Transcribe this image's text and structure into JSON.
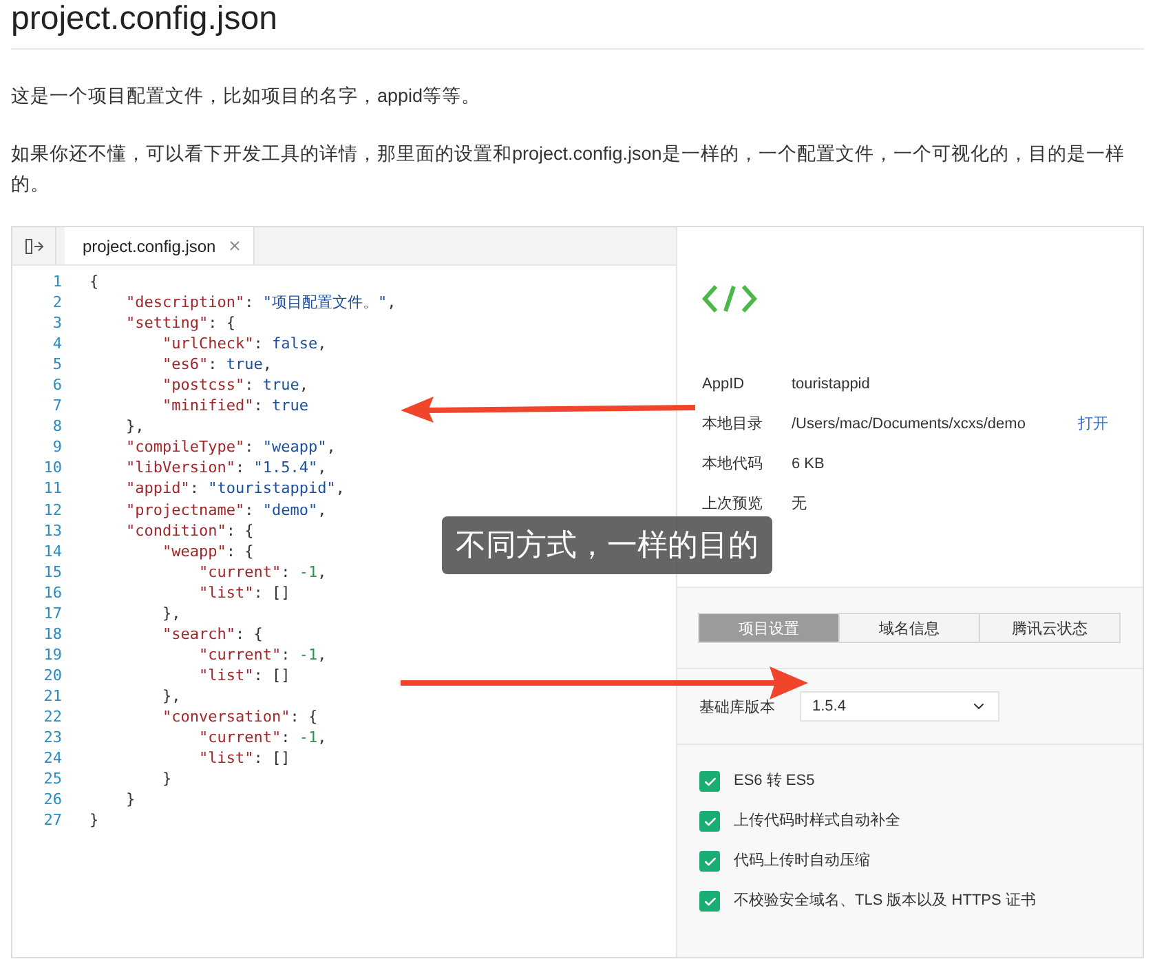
{
  "title": "project.config.json",
  "paragraphs": [
    "这是一个项目配置文件，比如项目的名字，appid等等。",
    "如果你还不懂，可以看下开发工具的详情，那里面的设置和project.config.json是一样的，一个配置文件，一个可视化的，目的是一样的。"
  ],
  "screenshot": {
    "editor": {
      "tab": {
        "label": "project.config.json",
        "selected": true
      },
      "lines": [
        {
          "num": "1",
          "tokens": [
            {
              "kind": "punct",
              "text": "{"
            }
          ]
        },
        {
          "num": "2",
          "tokens": [
            {
              "kind": "key",
              "text": "    \"description\""
            },
            {
              "kind": "punct",
              "text": ": "
            },
            {
              "kind": "string",
              "text": "\"项目配置文件。\""
            },
            {
              "kind": "punct",
              "text": ","
            }
          ]
        },
        {
          "num": "3",
          "tokens": [
            {
              "kind": "key",
              "text": "    \"setting\""
            },
            {
              "kind": "punct",
              "text": ": {"
            }
          ]
        },
        {
          "num": "4",
          "tokens": [
            {
              "kind": "key",
              "text": "        \"urlCheck\""
            },
            {
              "kind": "punct",
              "text": ": "
            },
            {
              "kind": "literal",
              "text": "false"
            },
            {
              "kind": "punct",
              "text": ","
            }
          ]
        },
        {
          "num": "5",
          "tokens": [
            {
              "kind": "key",
              "text": "        \"es6\""
            },
            {
              "kind": "punct",
              "text": ": "
            },
            {
              "kind": "literal",
              "text": "true"
            },
            {
              "kind": "punct",
              "text": ","
            }
          ]
        },
        {
          "num": "6",
          "tokens": [
            {
              "kind": "key",
              "text": "        \"postcss\""
            },
            {
              "kind": "punct",
              "text": ": "
            },
            {
              "kind": "literal",
              "text": "true"
            },
            {
              "kind": "punct",
              "text": ","
            }
          ]
        },
        {
          "num": "7",
          "tokens": [
            {
              "kind": "key",
              "text": "        \"minified\""
            },
            {
              "kind": "punct",
              "text": ": "
            },
            {
              "kind": "literal",
              "text": "true"
            }
          ]
        },
        {
          "num": "8",
          "tokens": [
            {
              "kind": "punct",
              "text": "    },"
            }
          ]
        },
        {
          "num": "9",
          "tokens": [
            {
              "kind": "key",
              "text": "    \"compileType\""
            },
            {
              "kind": "punct",
              "text": ": "
            },
            {
              "kind": "string",
              "text": "\"weapp\""
            },
            {
              "kind": "punct",
              "text": ","
            }
          ]
        },
        {
          "num": "10",
          "tokens": [
            {
              "kind": "key",
              "text": "    \"libVersion\""
            },
            {
              "kind": "punct",
              "text": ": "
            },
            {
              "kind": "string",
              "text": "\"1.5.4\""
            },
            {
              "kind": "punct",
              "text": ","
            }
          ]
        },
        {
          "num": "11",
          "tokens": [
            {
              "kind": "key",
              "text": "    \"appid\""
            },
            {
              "kind": "punct",
              "text": ": "
            },
            {
              "kind": "string",
              "text": "\"touristappid\""
            },
            {
              "kind": "punct",
              "text": ","
            }
          ]
        },
        {
          "num": "12",
          "tokens": [
            {
              "kind": "key",
              "text": "    \"projectname\""
            },
            {
              "kind": "punct",
              "text": ": "
            },
            {
              "kind": "string",
              "text": "\"demo\""
            },
            {
              "kind": "punct",
              "text": ","
            }
          ]
        },
        {
          "num": "13",
          "tokens": [
            {
              "kind": "key",
              "text": "    \"condition\""
            },
            {
              "kind": "punct",
              "text": ": {"
            }
          ]
        },
        {
          "num": "14",
          "tokens": [
            {
              "kind": "key",
              "text": "        \"weapp\""
            },
            {
              "kind": "punct",
              "text": ": {"
            }
          ]
        },
        {
          "num": "15",
          "tokens": [
            {
              "kind": "key",
              "text": "            \"current\""
            },
            {
              "kind": "punct",
              "text": ": "
            },
            {
              "kind": "number",
              "text": "-1"
            },
            {
              "kind": "punct",
              "text": ","
            }
          ]
        },
        {
          "num": "16",
          "tokens": [
            {
              "kind": "key",
              "text": "            \"list\""
            },
            {
              "kind": "punct",
              "text": ": []"
            }
          ]
        },
        {
          "num": "17",
          "tokens": [
            {
              "kind": "punct",
              "text": "        },"
            }
          ]
        },
        {
          "num": "18",
          "tokens": [
            {
              "kind": "key",
              "text": "        \"search\""
            },
            {
              "kind": "punct",
              "text": ": {"
            }
          ]
        },
        {
          "num": "19",
          "tokens": [
            {
              "kind": "key",
              "text": "            \"current\""
            },
            {
              "kind": "punct",
              "text": ": "
            },
            {
              "kind": "number",
              "text": "-1"
            },
            {
              "kind": "punct",
              "text": ","
            }
          ]
        },
        {
          "num": "20",
          "tokens": [
            {
              "kind": "key",
              "text": "            \"list\""
            },
            {
              "kind": "punct",
              "text": ": []"
            }
          ]
        },
        {
          "num": "21",
          "tokens": [
            {
              "kind": "punct",
              "text": "        },"
            }
          ]
        },
        {
          "num": "22",
          "tokens": [
            {
              "kind": "key",
              "text": "        \"conversation\""
            },
            {
              "kind": "punct",
              "text": ": {"
            }
          ]
        },
        {
          "num": "23",
          "tokens": [
            {
              "kind": "key",
              "text": "            \"current\""
            },
            {
              "kind": "punct",
              "text": ": "
            },
            {
              "kind": "number",
              "text": "-1"
            },
            {
              "kind": "punct",
              "text": ","
            }
          ]
        },
        {
          "num": "24",
          "tokens": [
            {
              "kind": "key",
              "text": "            \"list\""
            },
            {
              "kind": "punct",
              "text": ": []"
            }
          ]
        },
        {
          "num": "25",
          "tokens": [
            {
              "kind": "punct",
              "text": "        }"
            }
          ]
        },
        {
          "num": "26",
          "tokens": [
            {
              "kind": "punct",
              "text": "    }"
            }
          ]
        },
        {
          "num": "27",
          "tokens": [
            {
              "kind": "punct",
              "text": "}"
            }
          ]
        }
      ]
    },
    "details": {
      "rows": [
        {
          "label": "AppID",
          "value": "touristappid"
        },
        {
          "label": "本地目录",
          "value": "/Users/mac/Documents/xcxs/demo",
          "action": "打开"
        },
        {
          "label": "本地代码",
          "value": "6 KB"
        },
        {
          "label": "上次预览",
          "value": "无"
        }
      ]
    },
    "caption": "不同方式，一样的目的",
    "segments": [
      {
        "label": "项目设置",
        "selected": true
      },
      {
        "label": "域名信息",
        "selected": false
      },
      {
        "label": "腾讯云状态",
        "selected": false
      }
    ],
    "lib_version": {
      "label": "基础库版本",
      "value": "1.5.4"
    },
    "options": [
      {
        "label": "ES6 转 ES5",
        "checked": true
      },
      {
        "label": "上传代码时样式自动补全",
        "checked": true
      },
      {
        "label": "代码上传时自动压缩",
        "checked": true
      },
      {
        "label": "不校验安全域名、TLS 版本以及 HTTPS 证书",
        "checked": true
      }
    ]
  }
}
